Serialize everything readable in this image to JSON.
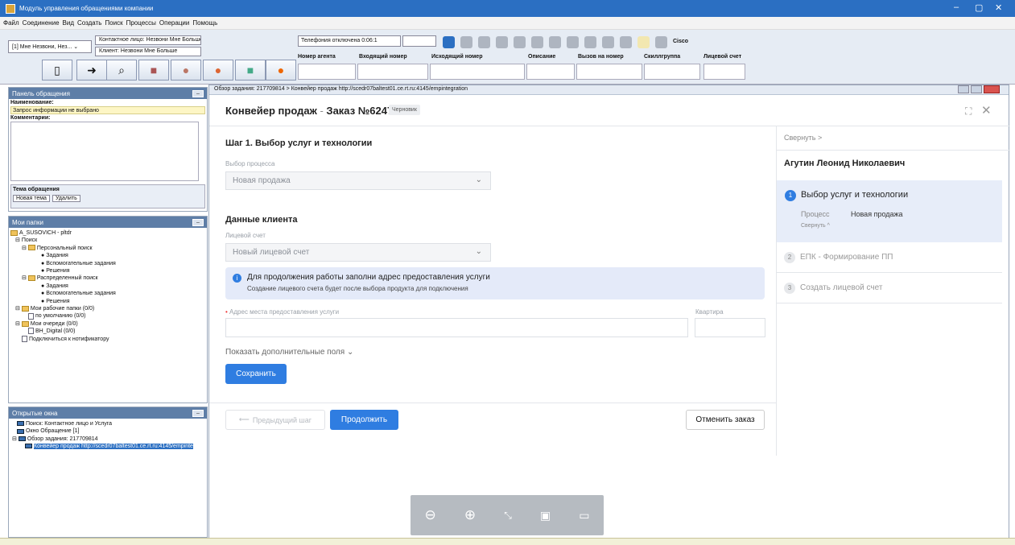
{
  "window": {
    "title": "Модуль управления обращениями компании",
    "controls": [
      "–",
      "▢",
      "✕"
    ]
  },
  "menu": [
    "Файл",
    "Соединение",
    "Вид",
    "Создать",
    "Поиск",
    "Процессы",
    "Операции",
    "Помощь"
  ],
  "toolbar": {
    "contact_combo": "[1] Мне Незвони, Нез... ⌄",
    "contact_label": "Контактное лицо: Незвони Мне Больше",
    "client_label": "Клиент: Незвони Мне Больше",
    "telephony": "Телефония отключена 0:06:1",
    "cisco": "Cisco",
    "columns": [
      "Номер агента",
      "Входящий номер",
      "Исходящий номер",
      "Описание",
      "Вызов на номер",
      "Скиллгруппа",
      "Лицевой счет"
    ]
  },
  "left": {
    "request_panel": "Панель обращения",
    "name_label": "Наименование:",
    "name_value": "Запрос информации не выбрано",
    "comments_label": "Комментарии:",
    "topic_label": "Тема обращения",
    "new_topic_btn": "Новая тема",
    "delete_btn": "Удалить",
    "folders_header": "Мои папки",
    "tree": [
      "A_SUSOVICH - pltdr",
      "Поиск",
      "Персональный поиск",
      "Задания",
      "Вспомогательные задания",
      "Решения",
      "Распределенный поиск",
      "Задания",
      "Вспомогательные задания",
      "Решения",
      "Мои рабочие папки (0/0)",
      "по умолчанию (0/0)",
      "Мои очереди (0/0)",
      "BH_Digital (0/0)",
      "Подключиться к нотификатору"
    ],
    "open_windows_header": "Открытые окна",
    "open_windows": [
      "Поиск: Контактное лицо и Услуга",
      "Окно Обращение [1]",
      "Обзор задания: 217709814",
      "Конвейер продаж http://scedr07baltest01.ce.rt.ru:4145/empinte"
    ]
  },
  "mdi_title": "Обзор задания: 217709814 > Конвейер продаж http://scedr07baltest01.ce.rt.ru:4145/empintegration",
  "order": {
    "title": "Конвейер продаж",
    "order_no": "Заказ №6247",
    "badge": "Черновик",
    "step1_title": "Шаг 1. Выбор услуг и технологии",
    "process_label": "Выбор процесса",
    "process_value": "Новая продажа",
    "client_section": "Данные клиента",
    "account_label": "Лицевой счет",
    "account_value": "Новый лицевой счет",
    "info_title": "Для продолжения работы заполни адрес предоставления услуги",
    "info_text": "Создание лицевого счета будет после выбора продукта для подключения",
    "address_label": "Адрес места предоставления услуги",
    "apartment_label": "Квартира",
    "more_fields": "Показать дополнительные поля ⌄",
    "save": "Сохранить",
    "prev": "Предыдущий шаг",
    "continue": "Продолжить",
    "cancel": "Отменить заказ"
  },
  "side": {
    "collapse": "Свернуть >",
    "customer": "Агутин Леонид Николаевич",
    "steps": [
      {
        "num": "1",
        "label": "Выбор услуг и технологии"
      },
      {
        "num": "2",
        "label": "ЕПК - Формирование ПП"
      },
      {
        "num": "3",
        "label": "Создать лицевой счет"
      }
    ],
    "process_key": "Процесс",
    "process_val": "Новая продажа",
    "collapse_small": "Свернуть ^"
  },
  "zoom_icons": [
    "zoom-out-icon",
    "zoom-in-icon",
    "fit-screen-icon",
    "presentation-icon",
    "comment-icon"
  ],
  "colors": {
    "accent": "#2f7de1",
    "titlebar": "#2b6fc2",
    "pane": "#5e7ea7"
  }
}
